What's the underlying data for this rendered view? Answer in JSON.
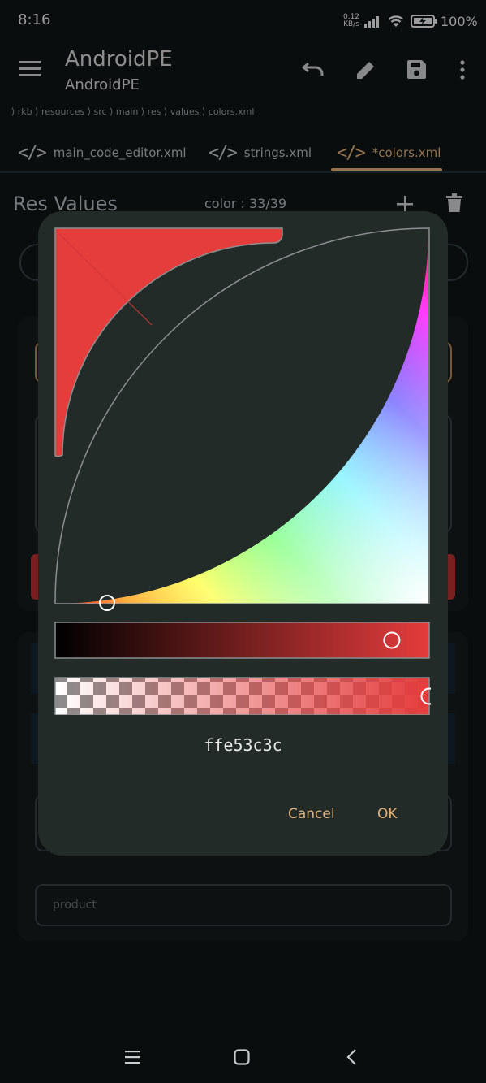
{
  "status_bar": {
    "time": "8:16",
    "net_speed_value": "0.12",
    "net_speed_unit": "KB/s",
    "battery_pct": "100%"
  },
  "app_bar": {
    "title": "AndroidPE",
    "subtitle": "AndroidPE",
    "icons": [
      "menu-icon",
      "undo-icon",
      "edit-icon",
      "save-icon",
      "more-vert-icon"
    ]
  },
  "breadcrumb": "⟩ rkb ⟩ resources ⟩ src ⟩ main ⟩ res ⟩ values ⟩ colors.xml",
  "tabs": [
    {
      "label": "main_code_editor.xml",
      "active": false
    },
    {
      "label": "strings.xml",
      "active": false
    },
    {
      "label": "*colors.xml",
      "active": true
    }
  ],
  "res_header": {
    "title": "Res Values",
    "count": "color : 33/39"
  },
  "background": {
    "product_placeholder": "product"
  },
  "color_picker": {
    "selected_color": "#e53c3c",
    "hex_value": "ffe53c3c",
    "brightness_level": 0.9,
    "alpha_level": 1.0,
    "cancel_label": "Cancel",
    "ok_label": "OK"
  },
  "colors": {
    "accent": "#e3b27a",
    "background": "#0e1416",
    "dialog": "#232b28"
  }
}
